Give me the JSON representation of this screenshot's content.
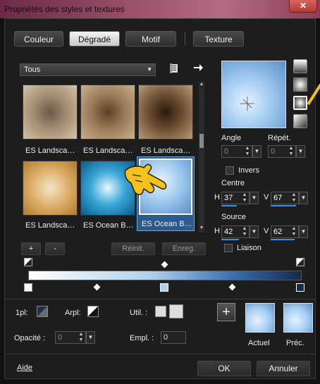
{
  "window": {
    "title": "Propriétés des styles et textures",
    "close": "✕"
  },
  "tabs": [
    {
      "label": "Couleur"
    },
    {
      "label": "Dégradé"
    },
    {
      "label": "Motif"
    },
    {
      "label": "Texture"
    }
  ],
  "filter": {
    "value": "Tous"
  },
  "gallery": {
    "items": [
      {
        "label": "ES Landsca…"
      },
      {
        "label": "ES Landsca…"
      },
      {
        "label": "ES Landsca…"
      },
      {
        "label": "ES Landsca…"
      },
      {
        "label": "ES Ocean B…"
      },
      {
        "label": "ES Ocean B…"
      }
    ]
  },
  "buttons": {
    "add": "+",
    "remove": "-",
    "reset": "Réinit.",
    "save": "Enreg.",
    "ok": "OK",
    "cancel": "Annuler"
  },
  "params": {
    "angle_label": "Angle",
    "angle": "0",
    "repeat_label": "Répét.",
    "repeat": "0",
    "invert_label": "Invers",
    "center_label": "Centre",
    "center_h_label": "H",
    "center_h": "37",
    "center_v_label": "V",
    "center_v": "67",
    "source_label": "Source",
    "source_h_label": "H",
    "source_h": "42",
    "source_v_label": "V",
    "source_v": "62",
    "link_label": "Liaison"
  },
  "bottom": {
    "fg_label": "1pl:",
    "bg_label": "Arpl:",
    "used_label": "Util. :",
    "opacity_label": "Opacité :",
    "opacity": "0",
    "location_label": "Empl. :",
    "location": "0",
    "current_label": "Actuel",
    "previous_label": "Préc.",
    "help": "Aide"
  },
  "colors": {
    "accent": "#3a8ee6",
    "highlight_border": "#ffffff"
  }
}
